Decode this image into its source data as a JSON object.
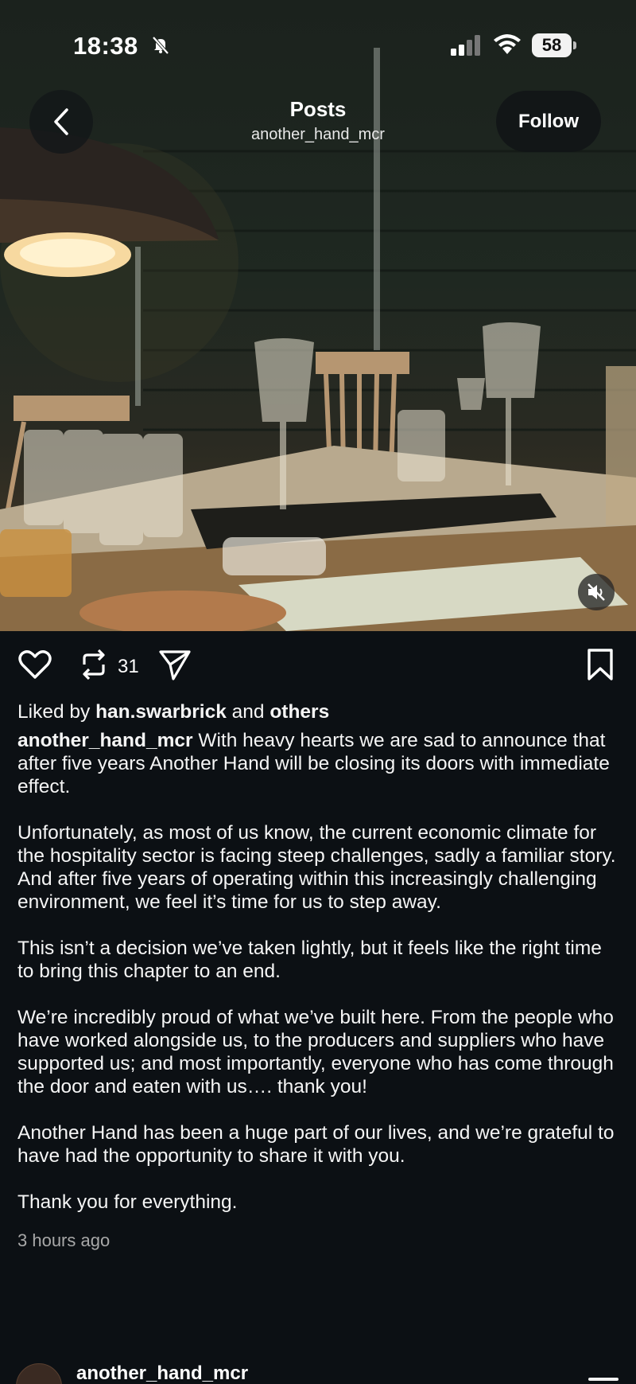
{
  "status_bar": {
    "time": "18:38",
    "battery": "58"
  },
  "header": {
    "title": "Posts",
    "username": "another_hand_mcr",
    "follow_label": "Follow"
  },
  "actions": {
    "repost_count": "31"
  },
  "post": {
    "liked_prefix": "Liked by ",
    "liked_user": "han.swarbrick",
    "liked_and": " and ",
    "liked_others": "others",
    "author": "another_hand_mcr",
    "paragraphs": [
      " With heavy hearts we are sad to announce that after five years Another Hand will be closing its doors with immediate effect.",
      "Unfortunately, as most of us know, the current economic climate for the hospitality sector is facing steep challenges, sadly a familiar story. And after five years of operating within this increasingly challenging environment, we feel it’s time for us to step away.",
      "This isn’t a decision we’ve taken lightly, but it feels like the right time to bring this chapter to an end.",
      "We’re incredibly proud of what we’ve built here. From the people who have worked alongside us, to the producers and suppliers who have supported us; and most importantly, everyone who has come through the door and eaten with us…. thank you!",
      "Another Hand has been a huge part of our lives, and we’re grateful to have had the opportunity to share it with you.",
      "Thank you for everything."
    ],
    "timestamp": "3 hours ago"
  },
  "next_post": {
    "username": "another_hand_mcr"
  },
  "icons": {
    "back": "chevron-left-icon",
    "mute": "speaker-muted-icon",
    "like": "heart-icon",
    "repost": "repost-icon",
    "share": "send-icon",
    "save": "bookmark-icon"
  }
}
